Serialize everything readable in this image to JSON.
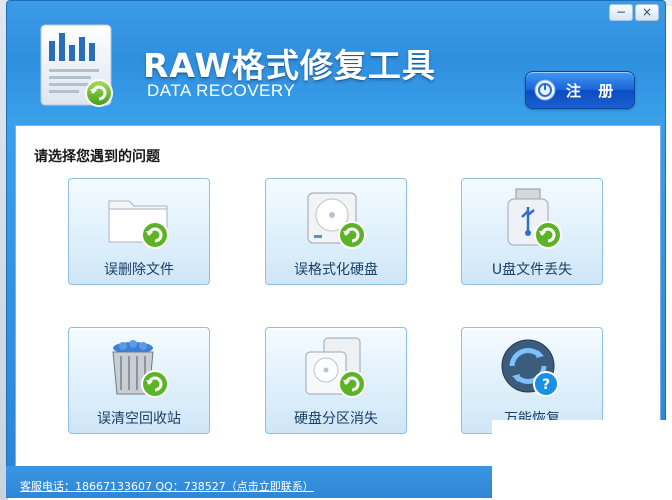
{
  "app": {
    "title": "RAW格式修复工具",
    "subtitle": "DATA RECOVERY",
    "register_label": "注 册",
    "window_buttons": {
      "minimize": "−",
      "close": "×"
    }
  },
  "main": {
    "prompt": "请选择您遇到的问题",
    "options": [
      {
        "label": "误删除文件",
        "icon": "folder-recover-icon"
      },
      {
        "label": "误格式化硬盘",
        "icon": "harddisk-recover-icon"
      },
      {
        "label": "U盘文件丢失",
        "icon": "usb-drive-recover-icon"
      },
      {
        "label": "误清空回收站",
        "icon": "recycle-bin-recover-icon"
      },
      {
        "label": "硬盘分区消失",
        "icon": "partition-recover-icon"
      },
      {
        "label": "万能恢复",
        "icon": "universal-recover-icon"
      }
    ]
  },
  "footer": {
    "contact": "客服电话：18667133607 QQ：738527（点击立即联系）"
  },
  "colors": {
    "window_blue": "#2f8fe0",
    "tile_border": "#8fbfe3",
    "recover_arrow": "#63b82a",
    "register_blue": "#1b63d8"
  }
}
